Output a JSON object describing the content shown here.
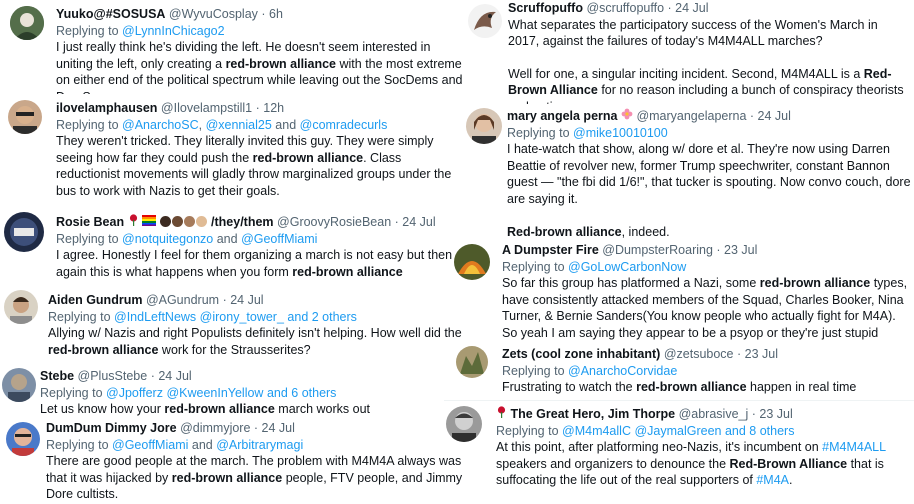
{
  "left": [
    {
      "name": "Yuuko@#SOSUSA",
      "handle": "@WyvuCosplay",
      "time": "· 6h",
      "replying_prefix": "Replying to",
      "reply_targets": [
        {
          "text": "@LynnInChicago2"
        }
      ],
      "paragraphs": [
        [
          {
            "t": "I just really think he's dividing the left. He doesn't seem interested in uniting the left, only creating a "
          },
          {
            "t": "red-brown alliance",
            "b": true
          },
          {
            "t": " with the most extreme on either end of the political spectrum while leaving out the SocDems and DemSocs."
          }
        ]
      ]
    },
    {
      "name": "ilovelamphausen",
      "handle": "@Ilovelampstill1",
      "time": "· 12h",
      "replying_prefix": "Replying to",
      "reply_targets": [
        {
          "text": "@AnarchoSC"
        },
        {
          "sep": ", "
        },
        {
          "text": "@xennial25"
        },
        {
          "sep": " and "
        },
        {
          "text": "@comradecurls"
        }
      ],
      "paragraphs": [
        [
          {
            "t": "They weren't tricked. They literally invited this guy. They were simply seeing how far they could push the "
          },
          {
            "t": "red-brown alliance",
            "b": true
          },
          {
            "t": ". Class reductionist movements will gladly throw marginalized groups under the bus to work with Nazis to get their goals."
          }
        ]
      ]
    },
    {
      "name": "Rosie Bean",
      "name_suffix": "/they/them",
      "handle": "@GroovyRosieBean",
      "time": "· 24 Jul",
      "replying_prefix": "Replying to",
      "reply_targets": [
        {
          "text": "@notquitegonzo"
        },
        {
          "sep": " and "
        },
        {
          "text": "@GeoffMiami"
        }
      ],
      "paragraphs": [
        [
          {
            "t": "I agree. Honestly I feel for them organizing a march is not easy but then again this is what happens when you form "
          },
          {
            "t": "red-brown alliance",
            "b": true
          }
        ]
      ]
    },
    {
      "name": "Aiden Gundrum",
      "handle": "@AGundrum",
      "time": "· 24 Jul",
      "replying_prefix": "Replying to",
      "reply_targets": [
        {
          "text": "@IndLeftNews"
        },
        {
          "sep": " "
        },
        {
          "text": "@irony_tower_"
        },
        {
          "sep": " "
        },
        {
          "text": "and 2 others"
        }
      ],
      "paragraphs": [
        [
          {
            "t": "Allying w/ Nazis and right Populists definitely isn't helping. How well did the "
          },
          {
            "t": "red-brown alliance",
            "b": true
          },
          {
            "t": " work for the Strausserites?"
          }
        ]
      ]
    },
    {
      "name": "Stebe",
      "handle": "@PlusStebe",
      "time": "· 24 Jul",
      "replying_prefix": "Replying to",
      "reply_targets": [
        {
          "text": "@Jpofferz"
        },
        {
          "sep": " "
        },
        {
          "text": "@KweenInYellow"
        },
        {
          "sep": " "
        },
        {
          "text": "and 6 others"
        }
      ],
      "paragraphs": [
        [
          {
            "t": "Let us know how your "
          },
          {
            "t": "red-brown alliance",
            "b": true
          },
          {
            "t": " march works out"
          }
        ]
      ]
    },
    {
      "name": "DumDum Dimmy Jore",
      "handle": "@dimmyjore",
      "time": "· 24 Jul",
      "replying_prefix": "Replying to",
      "reply_targets": [
        {
          "text": "@GeoffMiami"
        },
        {
          "sep": " and "
        },
        {
          "text": "@Arbitrarymagi"
        }
      ],
      "paragraphs": [
        [
          {
            "t": "There are good people at the march. The problem with M4M4A always was that it was hijacked by "
          },
          {
            "t": "red-brown alliance",
            "b": true
          },
          {
            "t": " people, FTV people, and Jimmy Dore cultists."
          }
        ]
      ]
    }
  ],
  "right": [
    {
      "name": "Scruffopuffo",
      "handle": "@scruffopuffo",
      "time": "· 24 Jul",
      "paragraphs": [
        [
          {
            "t": "What separates the participatory success of the Women's March in 2017, against the failures of today's M4M4ALL marches?"
          }
        ],
        [
          {
            "t": "Well for one, a singular inciting incident. Second, M4M4ALL is a "
          },
          {
            "t": "Red-Brown Alliance",
            "b": true
          },
          {
            "t": " for no reason including a bunch of conspiracy theorists and antivaxxers."
          }
        ]
      ]
    },
    {
      "name": "mary angela perna",
      "handle": "@maryangelaperna",
      "time": "· 24 Jul",
      "replying_prefix": "Replying to",
      "reply_targets": [
        {
          "text": "@mike10010100"
        }
      ],
      "paragraphs": [
        [
          {
            "t": "I hate-watch that show, along w/ dore et al. They're now using Darren Beattie of revolver new, former Trump speechwriter, constant Bannon guest — \"the fbi did 1/6!\", that tucker is spouting. Now convo couch, dore are saying it."
          }
        ],
        [
          {
            "t": "Red-brown alliance",
            "b": true
          },
          {
            "t": ", indeed."
          }
        ]
      ]
    },
    {
      "name": "A Dumpster Fire",
      "handle": "@DumpsterRoaring",
      "time": "· 23 Jul",
      "replying_prefix": "Replying to",
      "reply_targets": [
        {
          "text": "@GoLowCarbonNow"
        }
      ],
      "paragraphs": [
        [
          {
            "t": "So far this group has platformed a Nazi, some "
          },
          {
            "t": "red-brown alliance",
            "b": true
          },
          {
            "t": " types, have consistently attacked members of the Squad, Charles Booker, Nina Turner, & Bernie Sanders(You know people who actually fight for M4A). So yeah I am saying they appear to be a psyop or they're just stupid"
          }
        ]
      ]
    },
    {
      "name": "Zets (cool zone inhabitant)",
      "handle": "@zetsuboce",
      "time": "· 23 Jul",
      "replying_prefix": "Replying to",
      "reply_targets": [
        {
          "text": "@AnarchoCorvidae"
        }
      ],
      "paragraphs": [
        [
          {
            "t": "Frustrating to watch the "
          },
          {
            "t": "red-brown alliance",
            "b": true
          },
          {
            "t": " happen in real time"
          }
        ]
      ]
    },
    {
      "name": "The Great Hero, Jim Thorpe",
      "handle": "@abrasive_j",
      "time": "· 23 Jul",
      "replying_prefix": "Replying to",
      "reply_targets": [
        {
          "text": "@M4m4allC"
        },
        {
          "sep": " "
        },
        {
          "text": "@JaymalGreen"
        },
        {
          "sep": " "
        },
        {
          "text": "and 8 others"
        }
      ],
      "paragraphs": [
        [
          {
            "t": "At this point, after platforming neo-Nazis, it's incumbent on "
          },
          {
            "t": "#M4M4ALL",
            "l": true
          },
          {
            "t": " speakers and organizers to denounce the "
          },
          {
            "t": "Red-Brown Alliance",
            "b": true
          },
          {
            "t": " that is suffocating the life out of the real supporters of "
          },
          {
            "t": "#M4A",
            "l": true
          },
          {
            "t": "."
          }
        ]
      ]
    }
  ],
  "icons": {
    "rose": "rose-emoji-icon",
    "rainbow_flag": "rainbow-flag-emoji-icon",
    "fist": "raised-fist-emoji-icon"
  },
  "colors": {
    "link": "#1d9bf0",
    "secondary_text": "#536471",
    "primary_text": "#0f1419",
    "rose": "#c8102e"
  }
}
